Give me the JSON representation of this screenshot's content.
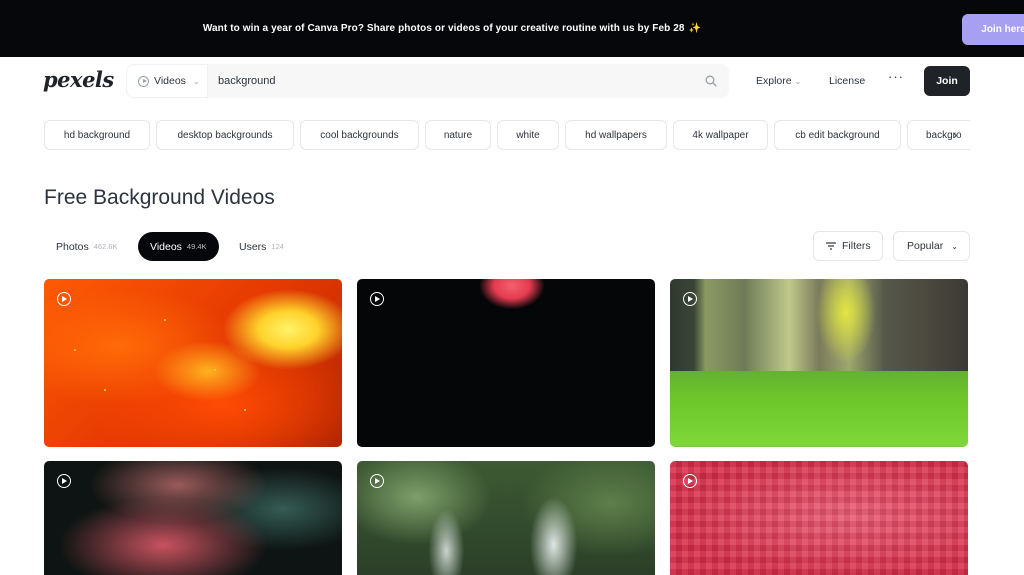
{
  "banner": {
    "text": "Want to win a year of Canva Pro? Share photos or videos of your creative routine with us by Feb 28",
    "sparkle": "✨",
    "cta": "Join here"
  },
  "header": {
    "logo": "pexels",
    "search_type": "Videos",
    "search_value": "background",
    "nav_explore": "Explore",
    "nav_license": "License",
    "nav_more": "···",
    "join": "Join"
  },
  "chips": [
    "hd background",
    "desktop backgrounds",
    "cool backgrounds",
    "nature",
    "white",
    "hd wallpapers",
    "4k wallpaper",
    "cb edit background",
    "backgro"
  ],
  "page_title": "Free Background Videos",
  "tabs": [
    {
      "label": "Photos",
      "count": "462.6K",
      "active": false
    },
    {
      "label": "Videos",
      "count": "49.4K",
      "active": true
    },
    {
      "label": "Users",
      "count": "124",
      "active": false
    }
  ],
  "filters_label": "Filters",
  "sort_label": "Popular",
  "colors": {
    "banner_bg": "#06070a",
    "join_here_bg": "#a79ff1",
    "join_bg": "#1f2328",
    "active_tab_bg": "#06070a"
  },
  "videos": [
    {
      "subject": "fire"
    },
    {
      "subject": "flower-in-dark"
    },
    {
      "subject": "grass"
    },
    {
      "subject": "colored-smoke"
    },
    {
      "subject": "waterfall"
    },
    {
      "subject": "red-pixels"
    }
  ]
}
